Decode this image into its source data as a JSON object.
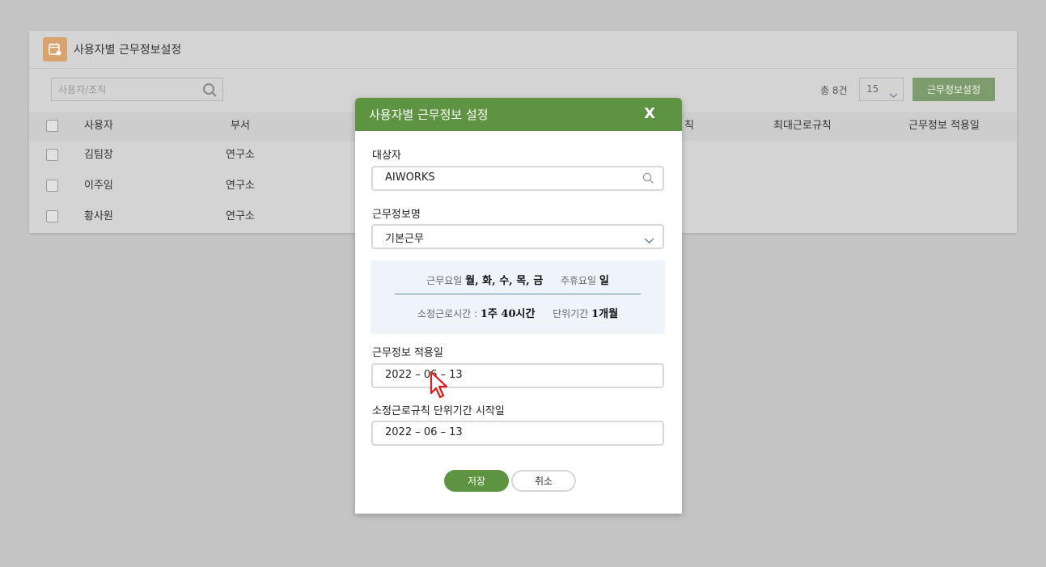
{
  "panel": {
    "title": "사용자별 근무정보설정",
    "search_placeholder": "사용자/조직",
    "total": "총 8건",
    "per_page": "15",
    "setting_button": "근무정보설정",
    "columns": [
      "사용자",
      "부서",
      "최대근로규칙",
      "근무정보 적용일"
    ],
    "column_partial": "칙",
    "rows": [
      {
        "user": "김팀장",
        "dept": "연구소"
      },
      {
        "user": "이주임",
        "dept": "연구소"
      },
      {
        "user": "황사원",
        "dept": "연구소"
      }
    ]
  },
  "modal": {
    "title": "사용자별 근무정보 설정",
    "close": "X",
    "target_label": "대상자",
    "target_value": "AIWORKS",
    "workinfo_label": "근무정보명",
    "workinfo_value": "기본근무",
    "info": {
      "workdays_label": "근무요일",
      "workdays_value": "월, 화, 수, 목, 금",
      "holiday_label": "주휴요일",
      "holiday_value": "일",
      "hours_label": "소정근로시간 :",
      "hours_value": "1주 40시간",
      "period_label": "단위기간",
      "period_value": "1개월"
    },
    "apply_date_label": "근무정보 적용일",
    "apply_date_value": "2022 – 06 – 13",
    "start_date_label": "소정근로규칙 단위기간 시작일",
    "start_date_value": "2022 – 06 – 13",
    "save_label": "저장",
    "cancel_label": "취소"
  },
  "colors": {
    "accent": "#5e9441",
    "panel_icon": "#d8a36c"
  }
}
